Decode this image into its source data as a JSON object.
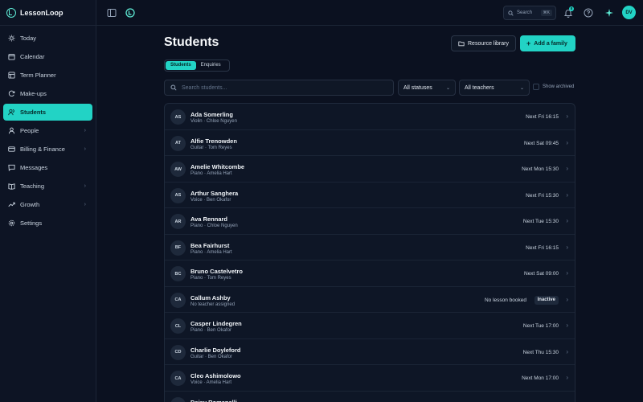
{
  "app": {
    "name": "LessonLoop"
  },
  "sidebar": {
    "items": [
      {
        "label": "Today",
        "icon": "sun-icon",
        "chevron": false,
        "active": false
      },
      {
        "label": "Calendar",
        "icon": "calendar-icon",
        "chevron": false,
        "active": false
      },
      {
        "label": "Term Planner",
        "icon": "planner-icon",
        "chevron": false,
        "active": false
      },
      {
        "label": "Make-ups",
        "icon": "refresh-icon",
        "chevron": false,
        "active": false
      },
      {
        "label": "Students",
        "icon": "users-icon",
        "chevron": false,
        "active": true
      },
      {
        "label": "People",
        "icon": "person-icon",
        "chevron": true,
        "active": false
      },
      {
        "label": "Billing & Finance",
        "icon": "card-icon",
        "chevron": true,
        "active": false
      },
      {
        "label": "Messages",
        "icon": "message-icon",
        "chevron": false,
        "active": false
      },
      {
        "label": "Teaching",
        "icon": "book-icon",
        "chevron": true,
        "active": false
      },
      {
        "label": "Growth",
        "icon": "trend-icon",
        "chevron": true,
        "active": false
      },
      {
        "label": "Settings",
        "icon": "gear-icon",
        "chevron": false,
        "active": false
      }
    ]
  },
  "topbar": {
    "search_label": "Search",
    "search_shortcut": "⌘K",
    "notif_count": "8",
    "user_initials": "DV"
  },
  "main": {
    "title": "Students",
    "resource_btn": "Resource library",
    "add_btn": "Add a family",
    "tabs": [
      "Students",
      "Enquiries"
    ],
    "search_placeholder": "Search students...",
    "status_filter": "All statuses",
    "teacher_filter": "All teachers",
    "archived_label": "Show archived"
  },
  "students": [
    {
      "initials": "AS",
      "name": "Ada Somerling",
      "sub": "Violin · Chloe Nguyen",
      "next": "Next Fri 16:15"
    },
    {
      "initials": "AT",
      "name": "Alfie Trenowden",
      "sub": "Guitar · Tom Reyes",
      "next": "Next Sat 09:45"
    },
    {
      "initials": "AW",
      "name": "Amelie Whitcombe",
      "sub": "Piano · Amelia Hart",
      "next": "Next Mon 15:30"
    },
    {
      "initials": "AS",
      "name": "Arthur Sanghera",
      "sub": "Voice · Ben Okafor",
      "next": "Next Fri 15:30"
    },
    {
      "initials": "AR",
      "name": "Ava Rennard",
      "sub": "Piano · Chloe Nguyen",
      "next": "Next Tue 15:30"
    },
    {
      "initials": "BF",
      "name": "Bea Fairhurst",
      "sub": "Piano · Amelia Hart",
      "next": "Next Fri 16:15"
    },
    {
      "initials": "BC",
      "name": "Bruno Castelvetro",
      "sub": "Piano · Tom Reyes",
      "next": "Next Sat 09:00"
    },
    {
      "initials": "CA",
      "name": "Callum Ashby",
      "sub": "No teacher assigned",
      "next": "No lesson booked",
      "badge": "Inactive"
    },
    {
      "initials": "CL",
      "name": "Casper Lindegren",
      "sub": "Piano · Ben Okafor",
      "next": "Next Tue 17:00"
    },
    {
      "initials": "CD",
      "name": "Charlie Doyleford",
      "sub": "Guitar · Ben Okafor",
      "next": "Next Thu 15:30"
    },
    {
      "initials": "CA",
      "name": "Cleo Ashimolowo",
      "sub": "Voice · Amelia Hart",
      "next": "Next Mon 17:00"
    },
    {
      "initials": "DR",
      "name": "Daisy Romanelli",
      "sub": "",
      "next": ""
    }
  ]
}
